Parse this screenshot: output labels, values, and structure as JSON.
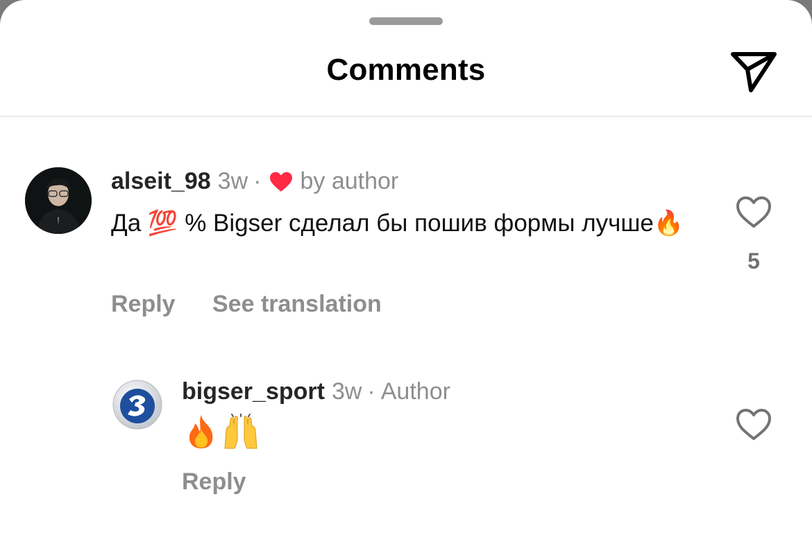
{
  "header": {
    "title": "Comments",
    "send_icon": "paper-plane-icon"
  },
  "comments": [
    {
      "username": "alseit_98",
      "time": "3w",
      "separator": "·",
      "liked_by_author_label": "by author",
      "text": "Да 💯 % Bigser сделал бы пошив формы лучше🔥",
      "reply_label": "Reply",
      "translate_label": "See translation",
      "likes": "5"
    },
    {
      "username": "bigser_sport",
      "time": "3w",
      "separator": "·",
      "author_badge": "Author",
      "text": "🔥🙌",
      "reply_label": "Reply"
    }
  ],
  "colors": {
    "muted_text": "#8e8e8e",
    "heart_red": "#ff2a44",
    "brand_blue": "#1e4f9e"
  }
}
